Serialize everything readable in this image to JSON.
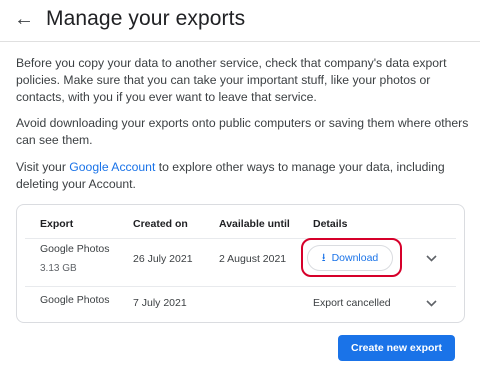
{
  "header": {
    "title": "Manage your exports"
  },
  "intro": {
    "p1": "Before you copy your data to another service, check that company's data export policies. Make sure that you can take your important stuff, like your photos or contacts, with you if you ever want to leave that service.",
    "p2": "Avoid downloading your exports onto public computers or saving them where others can see them.",
    "p3_before": "Visit your ",
    "p3_link": "Google Account",
    "p3_after": " to explore other ways to manage your data, including deleting your Account."
  },
  "table": {
    "headers": {
      "export": "Export",
      "created": "Created on",
      "available": "Available until",
      "details": "Details"
    },
    "rows": [
      {
        "export": "Google Photos",
        "size": "3.13 GB",
        "created": "26 July 2021",
        "available": "2 August 2021",
        "action": "Download"
      },
      {
        "export": "Google Photos",
        "created": "7 July 2021",
        "available": "",
        "status": "Export cancelled"
      }
    ]
  },
  "actions": {
    "create_new": "Create new export"
  },
  "colors": {
    "accent": "#1a73e8",
    "highlight": "#d6002a"
  },
  "icons": {
    "back": "arrow-back-icon",
    "download": "download-icon",
    "expand": "chevron-down-icon"
  }
}
